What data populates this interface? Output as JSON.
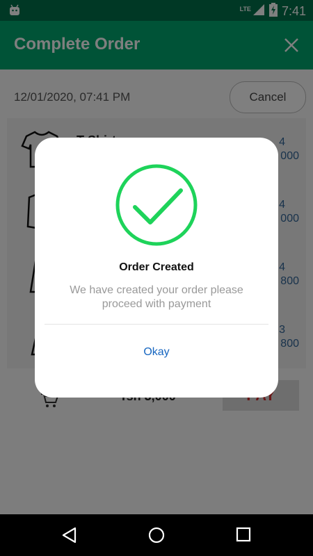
{
  "status_bar": {
    "network": "LTE",
    "time": "7:41"
  },
  "app_bar": {
    "title": "Complete Order"
  },
  "order": {
    "date": "12/01/2020, 07:41 PM",
    "cancel_label": "Cancel",
    "items": [
      {
        "name": "T-Shirt",
        "qty": "4",
        "price": "000",
        "icon": "tshirt-icon"
      },
      {
        "name": "",
        "qty": "4",
        "price": "000",
        "icon": "shirt-icon"
      },
      {
        "name": "",
        "qty": "4",
        "price": "800",
        "icon": "skirt-icon"
      },
      {
        "name": "",
        "qty": "3",
        "price": "800",
        "icon": "dress-icon"
      }
    ],
    "total": "Tsh 3,000",
    "pay_label": "PAY"
  },
  "dialog": {
    "title": "Order Created",
    "message": "We have created your order please proceed with payment",
    "ok_label": "Okay",
    "check_color": "#1ed35a"
  },
  "colors": {
    "primary": "#00a66e",
    "primary_dark": "#00704a",
    "link": "#1565c0"
  }
}
